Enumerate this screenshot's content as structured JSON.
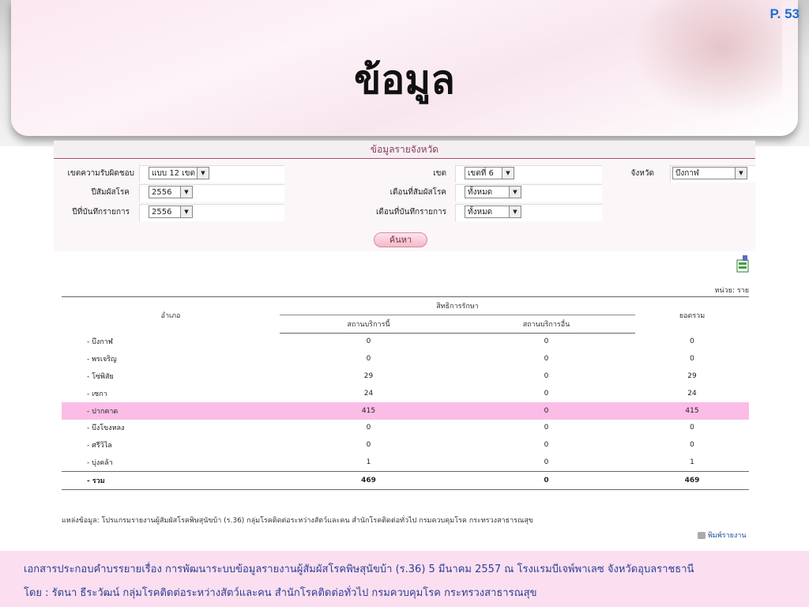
{
  "page_number": "P. 53",
  "title": "ข้อมูล",
  "panel_title": "ข้อมูลรายจังหวัด",
  "form": {
    "zone_resp_label": "เขตความรับผิดชอบ",
    "zone_resp_value": "แบบ 12 เขต",
    "zone_label": "เขต",
    "zone_value": "เขตที่ 6",
    "province_label": "จังหวัด",
    "province_value": "บึงกาฬ",
    "exposure_year_label": "ปีสัมผัสโรค",
    "exposure_year_value": "2556",
    "exposure_month_label": "เดือนที่สัมผัสโรค",
    "exposure_month_value": "ทั้งหมด",
    "record_year_label": "ปีที่บันทึกรายการ",
    "record_year_value": "2556",
    "record_month_label": "เดือนที่บันทึกรายการ",
    "record_month_value": "ทั้งหมด",
    "search_label": "ค้นหา"
  },
  "unit": "หน่วย: ราย",
  "table": {
    "col_district": "อำเภอ",
    "col_rights": "สิทธิการรักษา",
    "col_this_facility": "สถานบริการนี้",
    "col_other_facility": "สถานบริการอื่น",
    "col_total": "ยอดรวม",
    "rows": [
      {
        "name": "- บึงกาฬ",
        "this": "0",
        "other": "0",
        "total": "0"
      },
      {
        "name": "- พรเจริญ",
        "this": "0",
        "other": "0",
        "total": "0"
      },
      {
        "name": "- โซ่พิสัย",
        "this": "29",
        "other": "0",
        "total": "29"
      },
      {
        "name": "- เซกา",
        "this": "24",
        "other": "0",
        "total": "24"
      },
      {
        "name": "- ปากคาด",
        "this": "415",
        "other": "0",
        "total": "415"
      },
      {
        "name": "- บึงโขงหลง",
        "this": "0",
        "other": "0",
        "total": "0"
      },
      {
        "name": "- ศรีวิไล",
        "this": "0",
        "other": "0",
        "total": "0"
      },
      {
        "name": "- บุ่งคล้า",
        "this": "1",
        "other": "0",
        "total": "1"
      }
    ],
    "total_row": {
      "name": "- รวม",
      "this": "469",
      "other": "0",
      "total": "469"
    }
  },
  "source": "แหล่งข้อมูล: โปรแกรมรายงานผู้สัมผัสโรคพิษสุนัขบ้า (ร.36) กลุ่มโรคติดต่อระหว่างสัตว์และคน สำนักโรคติดต่อทั่วไป กรมควบคุมโรค กระทรวงสาธารณสุข",
  "print_label": "พิมพ์รายงาน",
  "footer": {
    "line1": "เอกสารประกอบคำบรรยายเรื่อง การพัฒนาระบบข้อมูลรายงานผู้สัมผัสโรคพิษสุนัขบ้า (ร.36)   5 มีนาคม 2557   ณ โรงแรมบีเจพ์พาเลซ จังหวัดอุบลราชธานี",
    "line2": "โดย : รัตนา ธีระวัฒน์ กลุ่มโรคติดต่อระหว่างสัตว์และคน   สำนักโรคติดต่อทั่วไป   กรมควบคุมโรค   กระทรวงสาธารณสุข"
  },
  "colors": {
    "highlight_row": "#fbbce8",
    "footer_bg": "#fbdff0",
    "footer_text": "#2c3f94",
    "page_num": "#1e6fd0"
  }
}
